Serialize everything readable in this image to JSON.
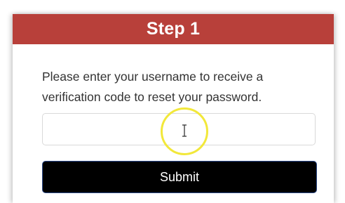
{
  "header": {
    "title": "Step 1",
    "color": "#b8403a"
  },
  "instructions": "Please enter your username to receive a verification code to reset your password.",
  "username_input": {
    "value": "",
    "placeholder": ""
  },
  "submit": {
    "label": "Submit"
  },
  "cursor": {
    "icon": "ibeam-cursor-icon",
    "highlight_color": "#f2e83a"
  }
}
